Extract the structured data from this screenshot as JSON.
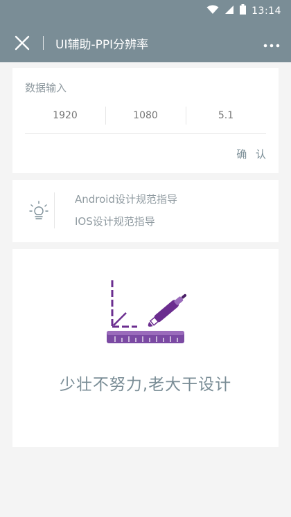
{
  "statusbar": {
    "time": "13:14"
  },
  "navbar": {
    "title": "UI辅助-PPI分辨率"
  },
  "input_card": {
    "label": "数据输入",
    "width_placeholder": "1920",
    "height_placeholder": "1080",
    "size_placeholder": "5.1",
    "confirm_label": "确 认"
  },
  "links": {
    "android": "Android设计规范指导",
    "ios": "IOS设计规范指导"
  },
  "hero": {
    "slogan": "少壮不努力,老大干设计"
  },
  "colors": {
    "primary": "#7a8d96",
    "accent": "#6b2d8f",
    "background": "#f4f4f4",
    "card": "#ffffff"
  }
}
